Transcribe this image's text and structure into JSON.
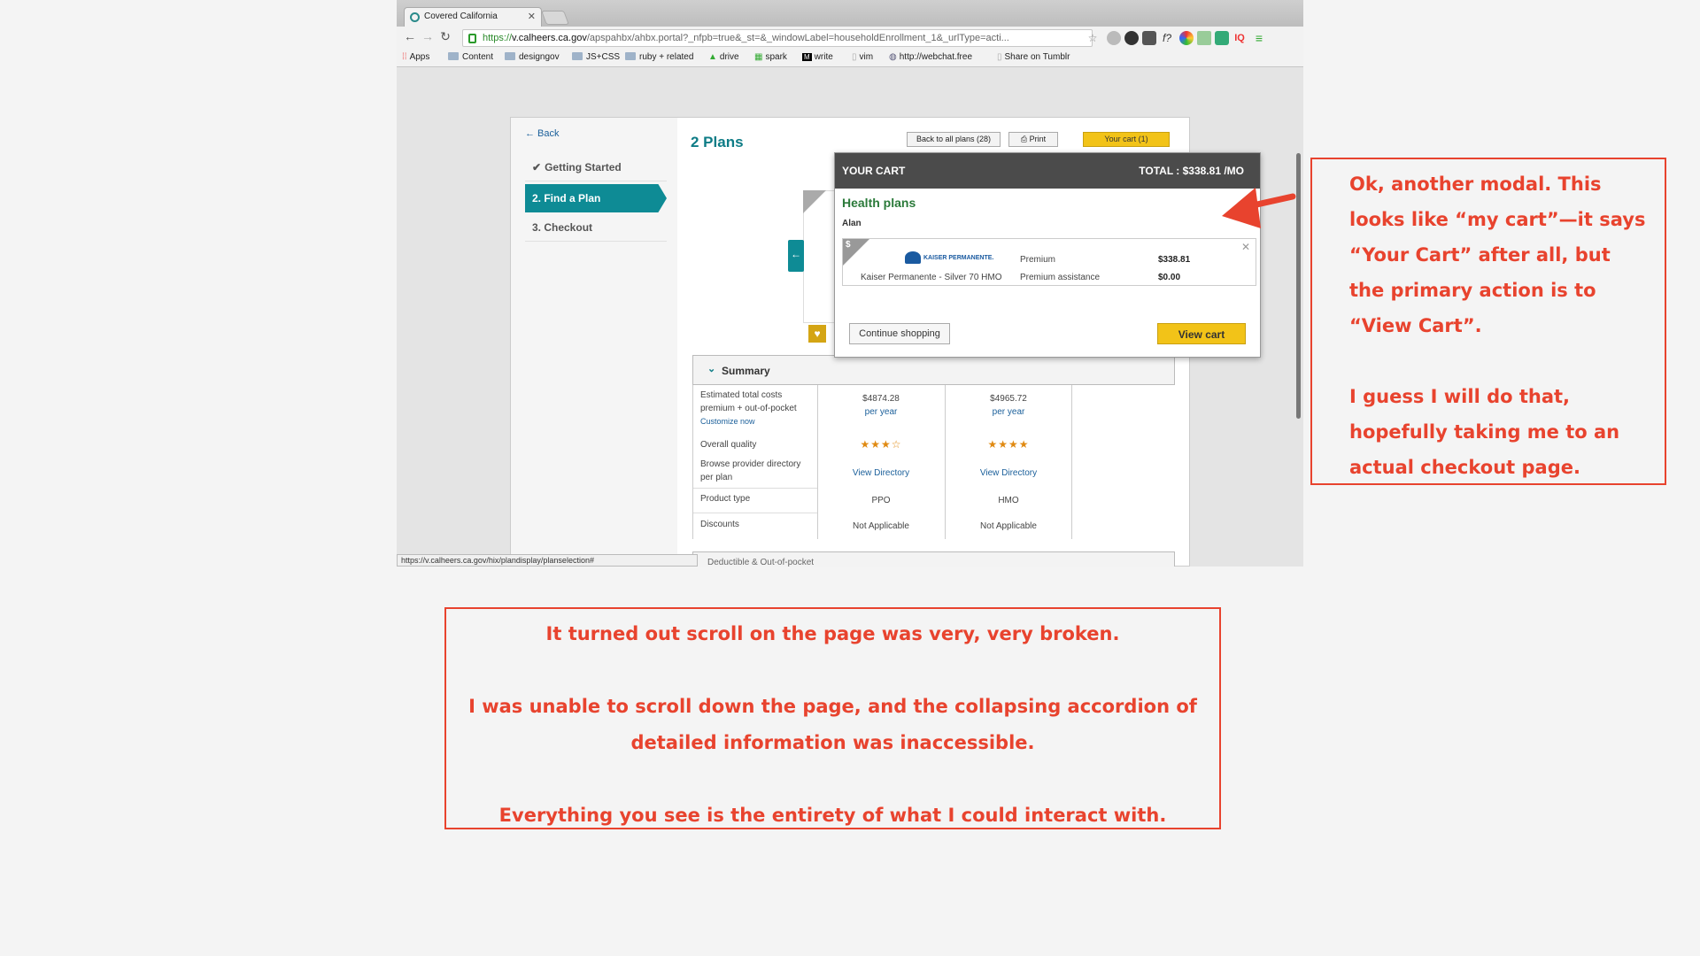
{
  "browser": {
    "tab_title": "Covered California",
    "url_scheme": "https://",
    "url_domain": "v.calheers.ca.gov",
    "url_rest": "/apspahbx/ahbx.portal?_nfpb=true&_st=&_windowLabel=householdEnrollment_1&_urlType=acti...",
    "bookmarks": [
      "Apps",
      "Content",
      "designgov",
      "JS+CSS",
      "ruby + related",
      "drive",
      "spark",
      "write",
      "vim",
      "http://webchat.free",
      "Share on Tumblr"
    ],
    "status_url": "https://v.calheers.ca.gov/hix/plandisplay/planselection#"
  },
  "page": {
    "back_label": "← Back",
    "steps": [
      "Getting Started",
      "2. Find a Plan",
      "3. Checkout"
    ],
    "title": "2 Plans",
    "back_to_all": "Back to all plans (28)",
    "print": "Print",
    "your_cart": "Your cart (1)",
    "summary_label": "Summary",
    "deductible_label": "Deductible & Out-of-pocket",
    "rows": {
      "costs_label_1": "Estimated total costs",
      "costs_label_2": "premium + out-of-pocket",
      "customize": "Customize now",
      "quality": "Overall quality",
      "directory_1": "Browse provider directory",
      "directory_2": "per plan",
      "product_type": "Product type",
      "discounts": "Discounts"
    },
    "plans": [
      {
        "cost": "$4874.28",
        "per_year": "per year",
        "stars": "★★★☆",
        "directory": "View Directory",
        "type": "PPO",
        "discounts": "Not Applicable"
      },
      {
        "cost": "$4965.72",
        "per_year": "per year",
        "stars": "★★★★",
        "directory": "View Directory",
        "type": "HMO",
        "discounts": "Not Applicable"
      }
    ]
  },
  "modal": {
    "header": "YOUR CART",
    "total": "TOTAL : $338.81 /MO",
    "section_title": "Health plans",
    "member": "Alan",
    "logo_text": "KAISER PERMANENTE.",
    "plan_name": "Kaiser Permanente - Silver 70 HMO",
    "premium_label": "Premium",
    "premium_value": "$338.81",
    "assist_label": "Premium assistance",
    "assist_value": "$0.00",
    "continue": "Continue shopping",
    "view_cart": "View cart"
  },
  "notes": {
    "right": [
      "Ok, another modal. This",
      "looks like “my cart”—it says",
      "“Your Cart” after all, but",
      "the primary action is to",
      "“View Cart”.",
      "",
      "I guess I will do that,",
      "hopefully taking me to an",
      "actual checkout page."
    ],
    "bottom": [
      "It turned out scroll on the page was very, very broken.",
      "",
      "I was unable to scroll down the page, and the collapsing accordion of",
      "detailed information was inaccessible.",
      "",
      "Everything you see is the entirety of what I could interact with."
    ]
  },
  "colors": {
    "accent": "#0e8b95",
    "annotation": "#e8432e",
    "cart_yellow": "#f2c318"
  }
}
